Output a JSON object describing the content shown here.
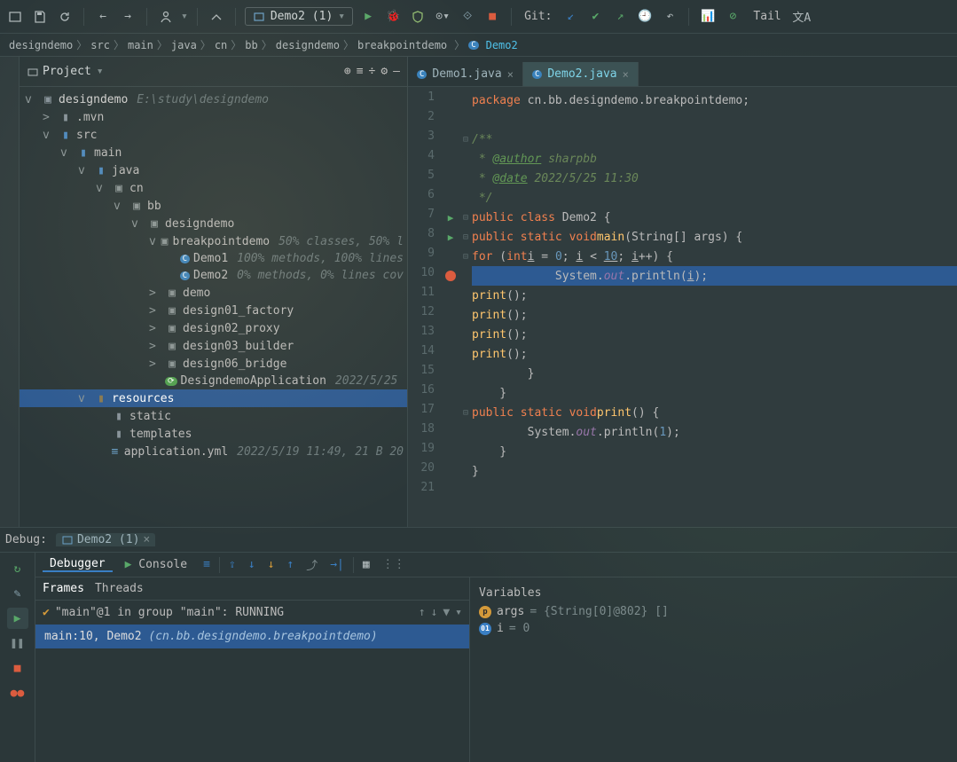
{
  "toolbar": {
    "runConfig": "Demo2 (1)",
    "gitLabel": "Git:",
    "tail": "Tail"
  },
  "breadcrumbs": [
    "designdemo",
    "src",
    "main",
    "java",
    "cn",
    "bb",
    "designdemo",
    "breakpointdemo"
  ],
  "breadcrumbActive": "Demo2",
  "projectPanel": {
    "title": "Project",
    "root": "designdemo",
    "rootPath": "E:\\study\\designdemo",
    "tree": [
      {
        "indent": 1,
        "toggle": ">",
        "icon": "folder",
        "label": ".mvn"
      },
      {
        "indent": 1,
        "toggle": "v",
        "icon": "folder-src",
        "label": "src"
      },
      {
        "indent": 2,
        "toggle": "v",
        "icon": "folder-src",
        "label": "main"
      },
      {
        "indent": 3,
        "toggle": "v",
        "icon": "folder-src",
        "label": "java"
      },
      {
        "indent": 4,
        "toggle": "v",
        "icon": "pkg",
        "label": "cn"
      },
      {
        "indent": 5,
        "toggle": "v",
        "icon": "pkg",
        "label": "bb"
      },
      {
        "indent": 6,
        "toggle": "v",
        "icon": "pkg",
        "label": "designdemo"
      },
      {
        "indent": 7,
        "toggle": "v",
        "icon": "pkg",
        "label": "breakpointdemo",
        "meta": "50% classes, 50% l"
      },
      {
        "indent": 8,
        "toggle": "",
        "icon": "class",
        "label": "Demo1",
        "meta": "100% methods, 100% lines"
      },
      {
        "indent": 8,
        "toggle": "",
        "icon": "class",
        "label": "Demo2",
        "meta": "0% methods, 0% lines cov"
      },
      {
        "indent": 7,
        "toggle": ">",
        "icon": "pkg",
        "label": "demo"
      },
      {
        "indent": 7,
        "toggle": ">",
        "icon": "pkg",
        "label": "design01_factory"
      },
      {
        "indent": 7,
        "toggle": ">",
        "icon": "pkg",
        "label": "design02_proxy"
      },
      {
        "indent": 7,
        "toggle": ">",
        "icon": "pkg",
        "label": "design03_builder"
      },
      {
        "indent": 7,
        "toggle": ">",
        "icon": "pkg",
        "label": "design06_bridge"
      },
      {
        "indent": 7,
        "toggle": "",
        "icon": "app",
        "label": "DesigndemoApplication",
        "meta": "2022/5/25"
      },
      {
        "indent": 3,
        "toggle": "v",
        "icon": "folder-res",
        "label": "resources",
        "selected": true
      },
      {
        "indent": 4,
        "toggle": "",
        "icon": "folder",
        "label": "static"
      },
      {
        "indent": 4,
        "toggle": "",
        "icon": "folder",
        "label": "templates"
      },
      {
        "indent": 4,
        "toggle": "",
        "icon": "yml",
        "label": "application.yml",
        "meta": "2022/5/19 11:49, 21 B 20"
      }
    ]
  },
  "tabs": [
    {
      "label": "Demo1.java",
      "active": false
    },
    {
      "label": "Demo2.java",
      "active": true
    }
  ],
  "code": {
    "lines": [
      {
        "n": 1,
        "html": "<span class='kw'>package</span> cn.bb.designdemo.breakpointdemo;"
      },
      {
        "n": 2,
        "html": ""
      },
      {
        "n": 3,
        "html": "<span class='doc'>/**</span>",
        "fold": "-"
      },
      {
        "n": 4,
        "html": "<span class='doc'> * </span><span class='ann'>@author</span><span class='doc'> sharpbb</span>"
      },
      {
        "n": 5,
        "html": "<span class='doc'> * </span><span class='ann'>@date</span><span class='doc'> 2022/5/25 11:30</span>"
      },
      {
        "n": 6,
        "html": "<span class='doc'> */</span>"
      },
      {
        "n": 7,
        "html": "<span class='kw'>public class</span> Demo2 {",
        "run": true,
        "fold": "-"
      },
      {
        "n": 8,
        "html": "    <span class='kw'>public static void</span> <span class='fn'>main</span>(String[] args) {",
        "run": true,
        "fold": "-"
      },
      {
        "n": 9,
        "html": "        <span class='kw'>for</span> (<span class='kw'>int</span> <u>i</u> = <span class='num'>0</span>; <u>i</u> &lt; <u><span class='num'>10</span></u>; <u>i</u>++) {",
        "fold": "-"
      },
      {
        "n": 10,
        "html": "            System.<span class='field'>out</span>.println(<u>i</u>);",
        "bp": true,
        "hl": true
      },
      {
        "n": 11,
        "html": "            <span class='fn'>print</span>();"
      },
      {
        "n": 12,
        "html": "            <span class='fn'>print</span>();"
      },
      {
        "n": 13,
        "html": "            <span class='fn'>print</span>();"
      },
      {
        "n": 14,
        "html": "            <span class='fn'>print</span>();"
      },
      {
        "n": 15,
        "html": "        }"
      },
      {
        "n": 16,
        "html": "    }"
      },
      {
        "n": 17,
        "html": "    <span class='kw'>public static void</span> <span class='fn'>print</span>() {",
        "fold": "-"
      },
      {
        "n": 18,
        "html": "        System.<span class='field'>out</span>.println(<span class='num'>1</span>);"
      },
      {
        "n": 19,
        "html": "    }"
      },
      {
        "n": 20,
        "html": "}"
      },
      {
        "n": 21,
        "html": ""
      }
    ]
  },
  "debug": {
    "label": "Debug:",
    "tabLabel": "Demo2 (1)",
    "toolTabs": {
      "debugger": "Debugger",
      "console": "Console"
    },
    "framesTabs": {
      "frames": "Frames",
      "threads": "Threads"
    },
    "thread": "\"main\"@1 in group \"main\": RUNNING",
    "frame": {
      "pos": "main:10, Demo2 ",
      "pkg": "(cn.bb.designdemo.breakpointdemo)"
    },
    "varsTitle": "Variables",
    "vars": [
      {
        "badge": "p",
        "name": "args",
        "value": "= {String[0]@802} []"
      },
      {
        "badge": "i",
        "name": "i",
        "value": "= 0"
      }
    ]
  }
}
